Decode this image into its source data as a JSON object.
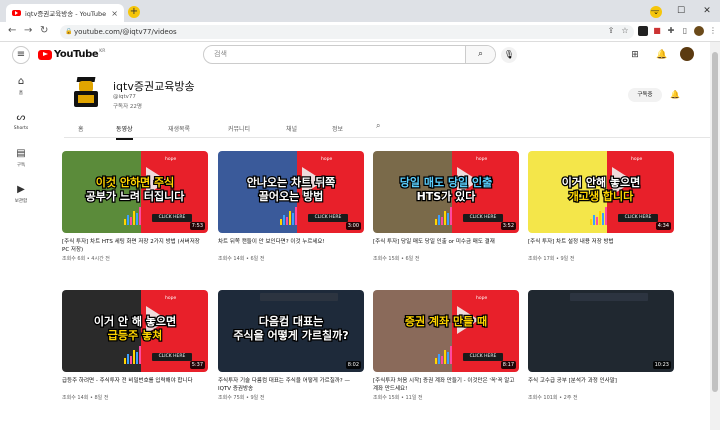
{
  "browser": {
    "tab_title": "iqtv증권교육방송 - YouTube",
    "tab_close": "×",
    "new_tab": "+",
    "address": "youtube.com/@iqtv77/videos",
    "win_min": "—",
    "win_max": "☐",
    "win_close": "✕"
  },
  "youtube": {
    "logo_text": "YouTube",
    "region": "KR",
    "search_placeholder": "검색"
  },
  "sidebar": {
    "items": [
      {
        "label": "홈",
        "icon": "home-icon"
      },
      {
        "label": "Shorts",
        "icon": "shorts-icon"
      },
      {
        "label": "구독",
        "icon": "subscriptions-icon"
      },
      {
        "label": "보관함",
        "icon": "library-icon"
      }
    ]
  },
  "channel": {
    "name": "iqtv증권교육방송",
    "handle": "@iqtv77",
    "subscribers": "구독자 22명",
    "subscribe_label": "구독중"
  },
  "tabs": [
    {
      "label": "홈"
    },
    {
      "label": "동영상",
      "active": true
    },
    {
      "label": "재생목록"
    },
    {
      "label": "커뮤니티"
    },
    {
      "label": "채널"
    },
    {
      "label": "정보"
    }
  ],
  "videos": [
    {
      "l1": "이것 안하면 주식",
      "l2": "공부가 느려 터집니다",
      "c1": "#ffd400",
      "c2": "#ffffff",
      "click": "CLICK HERE",
      "hope": "hope",
      "duration": "7:53",
      "title": "[주식 투자] 차트 HTS 세팅 화면 저장 2가지 방법 (서버저장 PC 저장)",
      "meta": "조회수 6회 • 4시간 전",
      "photo": "#5b8b3a"
    },
    {
      "l1": "안나오는 차트 뒤쪽",
      "l2": "끌어오는 방법",
      "c1": "#ffffff",
      "c2": "#ffffff",
      "click": "CLICK HERE",
      "hope": "hope",
      "duration": "3:00",
      "title": "차트 뒤쪽 캔들이 안 보인다면? 이것 누르세요!",
      "meta": "조회수 14회 • 6일 전",
      "photo": "#3a5a9a"
    },
    {
      "l1": "당일 매도 당일 인출",
      "l2": "HTS가 있다",
      "c1": "#5ad0ff",
      "c2": "#ffffff",
      "click": "CLICK HERE",
      "hope": "hope",
      "duration": "3:52",
      "title": "[주식 투자] 당일 매도 당일 인출 or 미수금 매도 결재",
      "meta": "조회수 15회 • 6일 전",
      "photo": "#7a6a4a"
    },
    {
      "l1": "이거 안해 놓으면",
      "l2": "개고생 합니다",
      "c1": "#ffffff",
      "c2": "#ffd400",
      "click": "CLICK HERE",
      "hope": "hope",
      "duration": "4:34",
      "title": "[주식 투자] 차트 설정 내용 저장 방법",
      "meta": "조회수 17회 • 9일 전",
      "photo": "#f4e64a"
    },
    {
      "l1": "이거 안 해 놓으면",
      "l2": "급등주 놓쳐",
      "c1": "#ffffff",
      "c2": "#ffd400",
      "click": "CLICK HERE",
      "hope": "hope",
      "duration": "5:37",
      "title": "급등주 하려면 - 주식투자 전 비밀번호를 입력해야 합니다",
      "meta": "조회수 14회 • 8일 전",
      "photo": "#2a2a2a"
    },
    {
      "l1": "다음컴 대표는",
      "l2": "주식을 어떻게 가르칠까?",
      "c1": "#ffffff",
      "c2": "#ffffff",
      "click": "",
      "hope": "",
      "duration": "8:02",
      "title": "주식투자 기술 다름컴 대표는 주식을 어떻게 가르칠까? — IQTV 증권방송",
      "meta": "조회수 75회 • 9일 전",
      "photo": "#1e2a3a",
      "dark": true
    },
    {
      "l1": "증권 계좌 만들 때",
      "l2": "",
      "c1": "#ffd400",
      "c2": "#ffffff",
      "click": "CLICK HERE",
      "hope": "hope",
      "duration": "8:17",
      "title": "[주식투자 처음 시작] 증권 계좌 만들기 - 이것만은 '꼭'꼭 알고 계좌 만드세요!",
      "meta": "조회수 15회 • 11일 전",
      "photo": "#8a6a5a"
    },
    {
      "l1": "",
      "l2": "",
      "c1": "#ffffff",
      "c2": "#ffffff",
      "click": "",
      "hope": "",
      "duration": "10:23",
      "title": "주식 고수급 공부 [분석가 과정 인사말]",
      "meta": "조회수 101회 • 2주 전",
      "photo": "#202830",
      "dark": true
    }
  ]
}
